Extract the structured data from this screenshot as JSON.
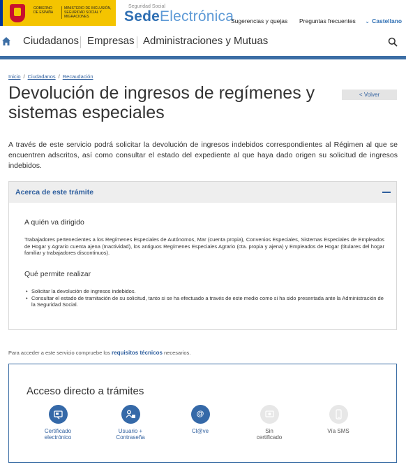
{
  "header": {
    "gov_line1": "GOBIERNO DE ESPAÑA",
    "gov_line2": "MINISTERIO DE INCLUSIÓN, SEGURIDAD SOCIAL Y MIGRACIONES",
    "brand_small": "Seguridad Social",
    "brand_bold": "Sede",
    "brand_light": "Electrónica",
    "links": {
      "suggestions": "Sugerencias y quejas",
      "faq": "Preguntas frecuentes",
      "language": "Castellano"
    }
  },
  "nav": {
    "items": [
      "Ciudadanos",
      "Empresas",
      "Administraciones y Mutuas"
    ]
  },
  "breadcrumb": [
    "Inicio",
    "Ciudadanos",
    "Recaudación"
  ],
  "page": {
    "title": "Devolución de ingresos de regímenes y sistemas especiales",
    "back_label": "< Volver",
    "intro": "A través de este servicio podrá solicitar la devolución de ingresos indebidos correspondientes al Régimen al que se encuentren adscritos, así como consultar el estado del expediente al que haya dado origen su solicitud de ingresos indebidos."
  },
  "panel": {
    "title": "Acerca de este trámite",
    "who_title": "A quién va dirigido",
    "who_text": "Trabajadores pertenecientes a los Regímenes Especiales de Autónomos, Mar (cuenta propia), Convenios Especiales, Sistemas Especiales de Empleados de Hogar y Agrario cuenta ajena (Inactividad), los antiguos Regímenes Especiales Agrario (cta. propia y ajena) y Empleados de Hogar (titulares del hogar familiar y trabajadores discontinuos).",
    "what_title": "Qué permite realizar",
    "what_items": [
      "Solicitar la devolución de ingresos indebidos.",
      "Consultar el estado de tramitación de su solicitud, tanto si se ha efectuado a través de este medio como si ha sido presentada ante la Administración de la Seguridad Social."
    ]
  },
  "requirements": {
    "prefix": "Para acceder a este servicio compruebe los",
    "link": "requisitos técnicos",
    "suffix": "necesarios."
  },
  "access": {
    "title": "Acceso directo a trámites",
    "options": [
      {
        "label1": "Certificado",
        "label2": "electrónico",
        "enabled": true
      },
      {
        "label1": "Usuario +",
        "label2": "Contraseña",
        "enabled": true
      },
      {
        "label1": "Cl@ve",
        "label2": "",
        "enabled": true
      },
      {
        "label1": "Sin",
        "label2": "certificado",
        "enabled": false
      },
      {
        "label1": "Vía SMS",
        "label2": "",
        "enabled": false
      }
    ]
  },
  "colors": {
    "gov_yellow": "#f4c400",
    "brand_blue": "#2f6fb3",
    "nav_bar": "#3c6ea5",
    "link_blue": "#2f5f9e"
  }
}
